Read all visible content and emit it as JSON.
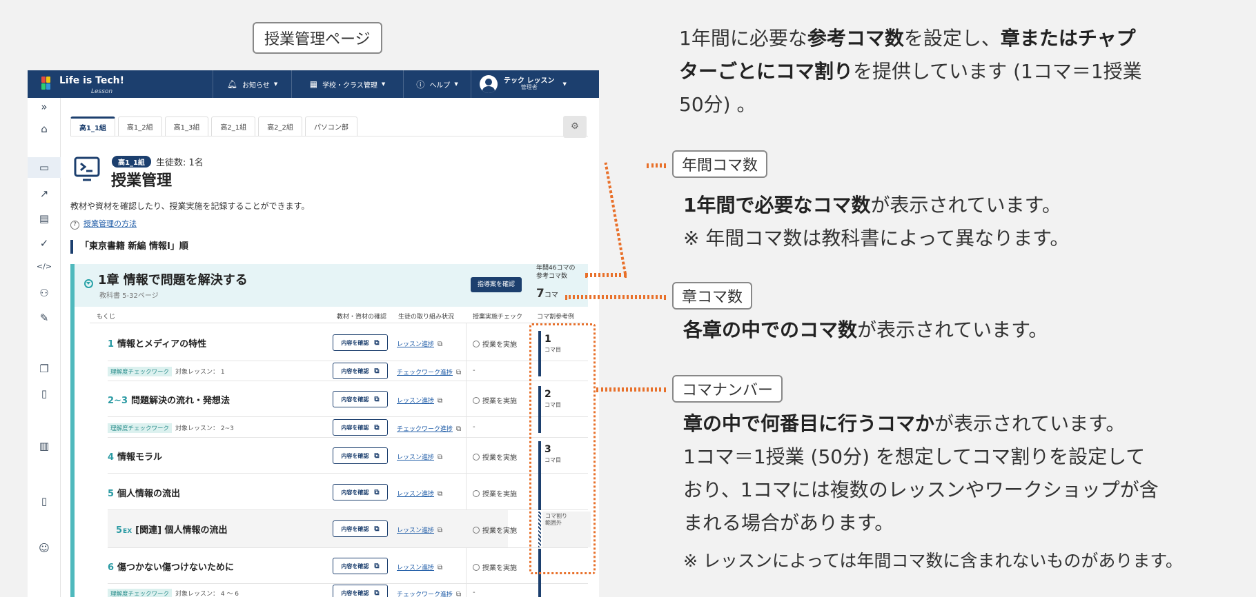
{
  "page_label": "授業管理ページ",
  "app": {
    "logo": {
      "name": "Life is Tech!",
      "sub": "Lesson"
    },
    "nav": {
      "notice": "お知らせ",
      "school_class": "学校・クラス管理",
      "help": "ヘルプ"
    },
    "user": {
      "name": "テック レッスン",
      "role": "管理者"
    },
    "tabs": [
      "高1_1組",
      "高1_2組",
      "高1_3組",
      "高2_1組",
      "高2_2組",
      "パソコン部"
    ],
    "class_badge": "高1_1組",
    "student_count": "生徒数: 1名",
    "title": "授業管理",
    "description": "教材や資材を確認したり、授業実施を記録することができます。",
    "howto_link": "授業管理の方法",
    "order": "「東京書籍 新編 情報Ⅰ」順",
    "chapter": {
      "title": "1章 情報で問題を解決する",
      "pages": "教科書 5-32ページ",
      "guide_button": "指導案を確認",
      "annual_label_1": "年間46コマの",
      "annual_label_2": "参考コマ数",
      "koma_count": "7",
      "koma_unit": "コマ"
    },
    "columns": {
      "toc": "もくじ",
      "materials": "教材・資材の確認",
      "progress": "生徒の取り組み状況",
      "implementation": "授業実施チェック",
      "koma": "コマ割参考例"
    },
    "labels": {
      "check_content": "内容を確認",
      "lesson_progress": "レッスン進捗",
      "checkwork_progress": "チェックワーク進捗",
      "implement": "授業を実施",
      "checkwork_badge": "理解度チェックワーク",
      "dash": "-",
      "koma_unit": "コマ目",
      "koma_out_1": "コマ割り",
      "koma_out_2": "範囲外"
    },
    "lessons": [
      {
        "num": "1",
        "title": "情報とメディアの特性"
      },
      {
        "num": "2~3",
        "title": "問題解決の流れ・発想法"
      },
      {
        "num": "4",
        "title": "情報モラル"
      },
      {
        "num": "5",
        "title": "個人情報の流出"
      },
      {
        "num": "5",
        "ex": "EX",
        "title": "[関連] 個人情報の流出"
      },
      {
        "num": "6",
        "title": "傷つかない傷つけないために"
      }
    ],
    "checkworks": [
      {
        "target": "対象レッスン： 1"
      },
      {
        "target": "対象レッスン： 2~3"
      },
      {
        "target": "対象レッスン： 4 〜 6"
      }
    ],
    "koma_numbers": [
      "1",
      "2",
      "3"
    ]
  },
  "intro": {
    "p1": "1年間に必要な",
    "b1": "参考コマ数",
    "p2": "を設定し、",
    "b2": "章またはチャプ",
    "b3": "ターごとにコマ割り",
    "p3": "を提供しています (1コマ＝1授業",
    "p4": "50分) 。"
  },
  "annual_koma": {
    "label": "年間コマ数",
    "bold": "1年間で必要なコマ数",
    "text": "が表示されています。",
    "note": "※ 年間コマ数は教科書によって異なります。"
  },
  "chapter_koma": {
    "label": "章コマ数",
    "bold": "各章の中でのコマ数",
    "text": "が表示されています。"
  },
  "koma_number": {
    "label": "コマナンバー",
    "bold": "章の中で何番目に行うコマか",
    "text": "が表示されています。",
    "line2": "1コマ＝1授業 (50分) を想定してコマ割りを設定して",
    "line3": "おり、1コマには複数のレッスンやワークショップが含",
    "line4": "まれる場合があります。",
    "note": "※ レッスンによっては年間コマ数に含まれないものがあります。"
  },
  "colors": {
    "navy": "#1c3f6e",
    "teal": "#4fb9bd",
    "orange": "#e8702a"
  }
}
